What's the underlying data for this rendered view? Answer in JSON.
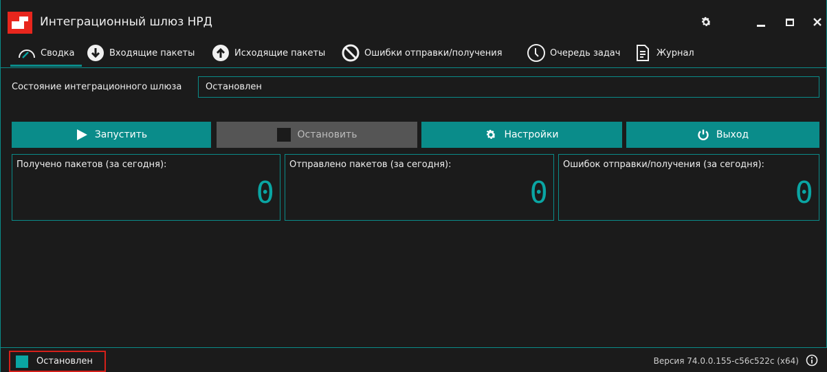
{
  "window": {
    "title": "Интеграционный шлюз НРД"
  },
  "tabs": [
    {
      "label": "Сводка",
      "icon": "gauge-icon",
      "active": true
    },
    {
      "label": "Входящие пакеты",
      "icon": "arrow-down-circle-icon"
    },
    {
      "label": "Исходящие пакеты",
      "icon": "arrow-up-circle-icon"
    },
    {
      "label": "Ошибки отправки/получения",
      "icon": "forbidden-icon"
    },
    {
      "label": "Очередь задач",
      "icon": "clock-icon"
    },
    {
      "label": "Журнал",
      "icon": "document-icon"
    }
  ],
  "state": {
    "label": "Состояние интеграционного шлюза",
    "value": "Остановлен"
  },
  "buttons": {
    "start": "Запустить",
    "stop": "Остановить",
    "settings": "Настройки",
    "exit": "Выход"
  },
  "cards": [
    {
      "label": "Получено пакетов (за сегодня):",
      "value": "0"
    },
    {
      "label": "Отправлено пакетов (за сегодня):",
      "value": "0"
    },
    {
      "label": "Ошибок отправки/получения (за сегодня):",
      "value": "0"
    }
  ],
  "statusbar": {
    "status": "Остановлен",
    "version": "Версия 74.0.0.155-c56c522c (x64)"
  },
  "colors": {
    "accent": "#0a8c8a",
    "counter": "#0aa5a3",
    "background": "#1b1b1b",
    "disabled_button": "#555555",
    "logo_red": "#e8261d",
    "highlight_red": "#d6201a"
  }
}
